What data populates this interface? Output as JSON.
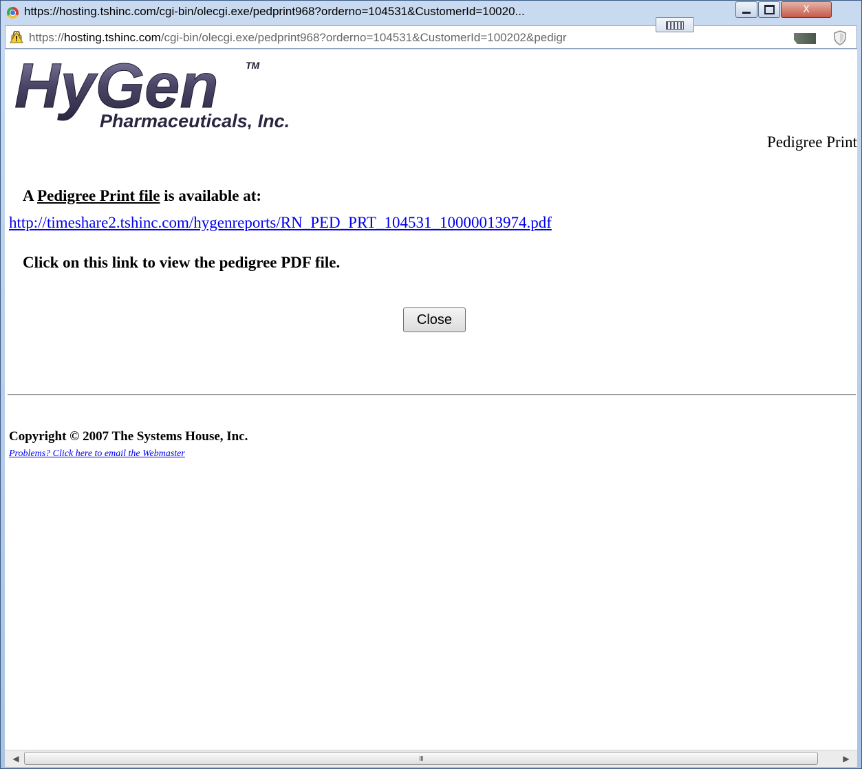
{
  "window": {
    "title": "https://hosting.tshinc.com/cgi-bin/olecgi.exe/pedprint968?orderno=104531&CustomerId=10020...",
    "minimize_label": "",
    "maximize_label": "",
    "close_label": "X"
  },
  "addressbar": {
    "scheme": "https://",
    "host": "hosting.tshinc.com",
    "path": "/cgi-bin/olecgi.exe/pedprint968?orderno=104531&CustomerId=100202&pedigr"
  },
  "logo": {
    "main": "HyGen",
    "trademark": "TM",
    "subtitle": "Pharmaceuticals, Inc."
  },
  "header": {
    "right_label": "Pedigree Print"
  },
  "message": {
    "prefix": "A ",
    "link_phrase": "Pedigree Print file",
    "suffix": " is available at:",
    "pdf_url": "http://timeshare2.tshinc.com/hygenreports/RN_PED_PRT_104531_10000013974.pdf",
    "instruction": "Click on this link to view the pedigree PDF file."
  },
  "actions": {
    "close_label": "Close"
  },
  "footer": {
    "copyright": "Copyright © 2007 The Systems House, Inc.",
    "webmaster_link": "Problems? Click here to email the Webmaster"
  },
  "scrollbar": {
    "grip": "III"
  },
  "icons": {
    "browser": "chrome-icon",
    "security": "warning-lock-icon",
    "extension": "extension-icon",
    "shield": "shield-icon"
  },
  "colors": {
    "link": "#0000ee",
    "logo_dark": "#3a3550",
    "frame": "#a9c3e3"
  }
}
